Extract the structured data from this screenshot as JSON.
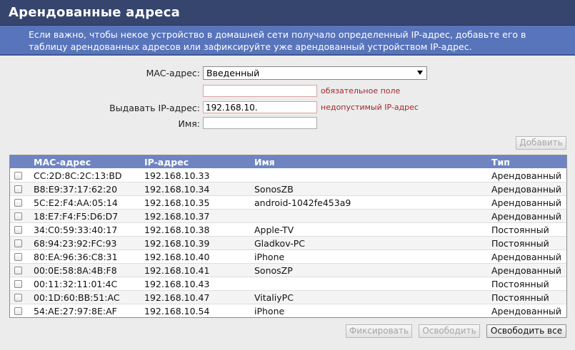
{
  "header": {
    "title": "Арендованные адреса"
  },
  "info": {
    "text": "Если важно, чтобы некое устройство в домашней сети получало определенный IP-адрес, добавьте его в таблицу арендованных адресов или зафиксируйте уже арендованный устройством IP-адрес."
  },
  "form": {
    "mac_label": "MAC-адрес:",
    "mac_select_value": "Введенный",
    "mac_input_value": "",
    "mac_hint": "обязательное поле",
    "ip_label": "Выдавать IP-адрес:",
    "ip_value": "192.168.10.",
    "ip_hint": "недопустимый IP-адрес",
    "name_label": "Имя:",
    "name_value": "",
    "add_button": "Добавить"
  },
  "table": {
    "columns": [
      "MAC-адрес",
      "IP-адрес",
      "Имя",
      "Тип"
    ],
    "rows": [
      {
        "mac": "CC:2D:8C:2C:13:BD",
        "ip": "192.168.10.33",
        "name": "",
        "type": "Арендованный"
      },
      {
        "mac": "B8:E9:37:17:62:20",
        "ip": "192.168.10.34",
        "name": "SonosZB",
        "type": "Арендованный"
      },
      {
        "mac": "5C:E2:F4:AA:05:14",
        "ip": "192.168.10.35",
        "name": "android-1042fe453a9",
        "type": "Арендованный"
      },
      {
        "mac": "18:E7:F4:F5:D6:D7",
        "ip": "192.168.10.37",
        "name": "",
        "type": "Арендованный"
      },
      {
        "mac": "34:C0:59:33:40:17",
        "ip": "192.168.10.38",
        "name": "Apple-TV",
        "type": "Постоянный"
      },
      {
        "mac": "68:94:23:92:FC:93",
        "ip": "192.168.10.39",
        "name": "Gladkov-PC",
        "type": "Постоянный"
      },
      {
        "mac": "80:EA:96:36:C8:31",
        "ip": "192.168.10.40",
        "name": "iPhone",
        "type": "Арендованный"
      },
      {
        "mac": "00:0E:58:8A:4B:F8",
        "ip": "192.168.10.41",
        "name": "SonosZP",
        "type": "Арендованный"
      },
      {
        "mac": "00:11:32:11:01:4C",
        "ip": "192.168.10.43",
        "name": "",
        "type": "Постоянный"
      },
      {
        "mac": "00:1D:60:BB:51:AC",
        "ip": "192.168.10.47",
        "name": "VitaliyPC",
        "type": "Постоянный"
      },
      {
        "mac": "54:AE:27:97:8E:AF",
        "ip": "192.168.10.54",
        "name": "iPhone",
        "type": "Арендованный"
      }
    ]
  },
  "buttons": {
    "fix": "Фиксировать",
    "release": "Освободить",
    "release_all": "Освободить все"
  },
  "colors": {
    "title_bar": "#35456e",
    "info_bar": "#5874ba",
    "table_header": "#6f84c1",
    "hint_text": "#a0282a"
  }
}
